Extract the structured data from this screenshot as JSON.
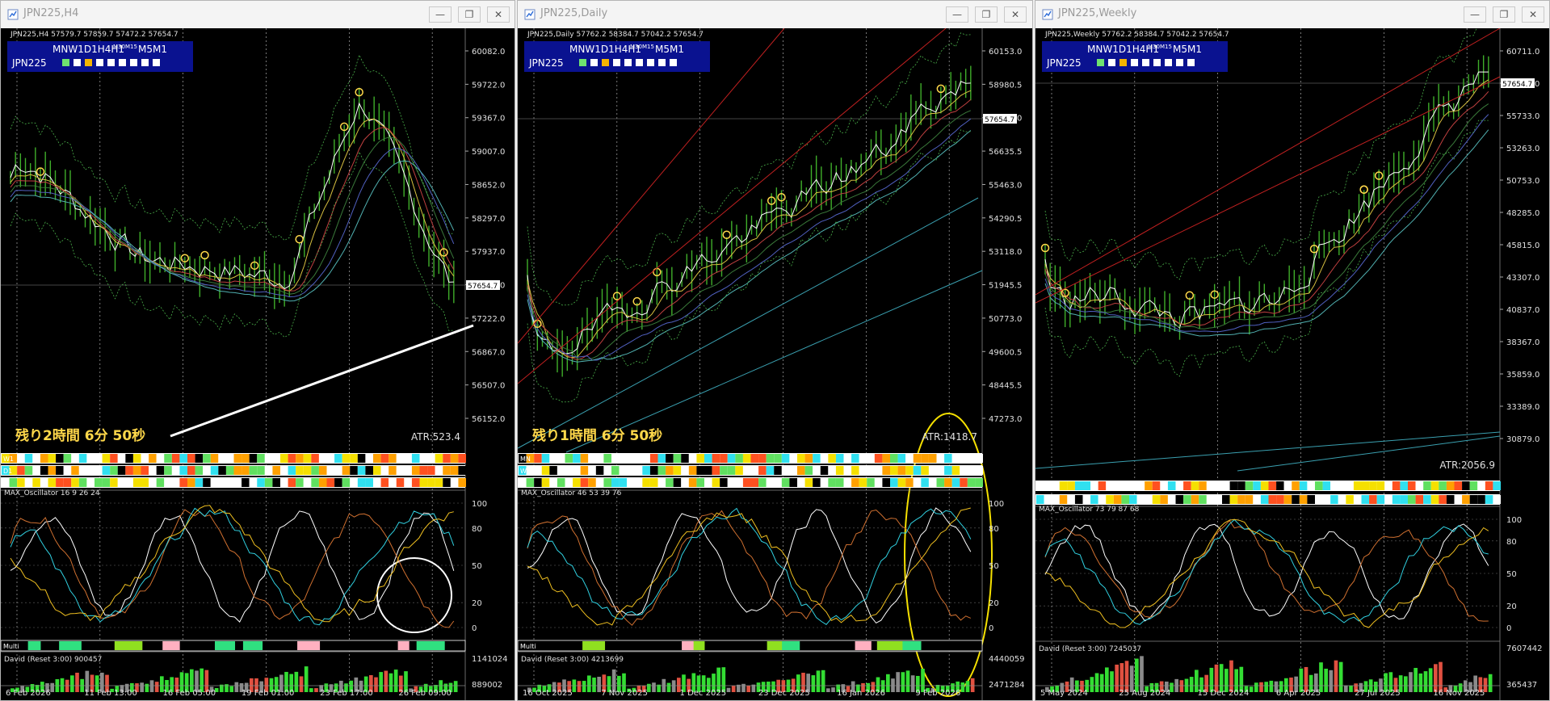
{
  "windows": [
    {
      "title": "JPN225,H4",
      "header": "JPN225,H4  57579.7 57859.7 57472.2 57654.7",
      "panel": {
        "tf_row": "MNW1D1H4H1",
        "tf_small": "M30M15",
        "tf_tail": "M5M1",
        "symbol": "JPN225"
      },
      "current_price": "57654.7",
      "price_ticks": [
        "60082.0",
        "59722.0",
        "59367.0",
        "59007.0",
        "58652.0",
        "58297.0",
        "57937.0",
        "57582.0",
        "57222.0",
        "56867.0",
        "56507.0",
        "56152.0"
      ],
      "remaining": "残り2時間 6分 50秒",
      "atr": "ATR:523.4",
      "heat_labels": [
        "W1",
        "D1",
        ""
      ],
      "oscillator_label": "MAX_Oscillator 16 9 26 24",
      "osc_ticks": [
        "100",
        "80",
        "50",
        "20",
        "0"
      ],
      "multi_label": "Multi",
      "david_label": "David (Reset 3:00) 900457",
      "david_ticks": [
        "1141024",
        "889002"
      ],
      "dates": [
        "6 Feb 2026",
        "11 Feb 13:00",
        "16 Feb 05:00",
        "19 Feb 01:00",
        "23 Feb 17:00",
        "26 Feb 09:00"
      ]
    },
    {
      "title": "JPN225,Daily",
      "header": "JPN225,Daily  57762.2 58384.7 57042.2 57654.7",
      "panel": {
        "tf_row": "MNW1D1H4H1",
        "tf_small": "M30M15",
        "tf_tail": "M5M1",
        "symbol": "JPN225"
      },
      "current_price": "57654.7",
      "price_ticks": [
        "60153.0",
        "58980.5",
        "57808.0",
        "56635.5",
        "55463.0",
        "54290.5",
        "53118.0",
        "51945.5",
        "50773.0",
        "49600.5",
        "48445.5",
        "47273.0"
      ],
      "remaining": "残り1時間 6分 50秒",
      "atr": "ATR:1418.7",
      "heat_labels": [
        "MN",
        "W1",
        ""
      ],
      "oscillator_label": "MAX_Oscillator 46 53 39 76",
      "osc_ticks": [
        "100",
        "80",
        "50",
        "20",
        "0"
      ],
      "multi_label": "Multi",
      "david_label": "David (Reset 3:00) 4213699",
      "david_ticks": [
        "4440059",
        "2471284"
      ],
      "dates": [
        "16 Oct 2025",
        "7 Nov 2025",
        "1 Dec 2025",
        "23 Dec 2025",
        "16 Jan 2026",
        "9 Feb 2026"
      ]
    },
    {
      "title": "JPN225,Weekly",
      "header": "JPN225,Weekly  57762.2 58384.7 57042.2 57654.7",
      "panel": {
        "tf_row": "MNW1D1H4H1",
        "tf_small": "M30M15",
        "tf_tail": "M5M1",
        "symbol": "JPN225"
      },
      "current_price": "57654.7",
      "price_ticks": [
        "60711.0",
        "58203.0",
        "55733.0",
        "53263.0",
        "50753.0",
        "48285.0",
        "45815.0",
        "43307.0",
        "40837.0",
        "38367.0",
        "35859.0",
        "33389.0",
        "30879.0"
      ],
      "remaining": "",
      "atr": "ATR:2056.9",
      "heat_labels": [
        "MN",
        ""
      ],
      "oscillator_label": "MAX_Oscillator 73 79 87 68",
      "osc_ticks": [
        "100",
        "80",
        "50",
        "20",
        "0"
      ],
      "multi_label": "",
      "david_label": "David (Reset 3:00) 7245037",
      "david_ticks": [
        "7607442",
        "365437"
      ],
      "dates": [
        "5 May 2024",
        "25 Aug 2024",
        "15 Dec 2024",
        "6 Apr 2025",
        "27 Jul 2025",
        "16 Nov 2025"
      ]
    }
  ],
  "buttons": {
    "minimize": "—",
    "restore": "❐",
    "close": "✕"
  },
  "colors": {
    "bg": "#000000",
    "candle": "#3fae2a",
    "panel_bg": "#0a1290",
    "label_yellow": "#ffd84a",
    "david_green": "#33dd33",
    "david_red": "#e05040",
    "david_gray": "#8a8a8a"
  }
}
